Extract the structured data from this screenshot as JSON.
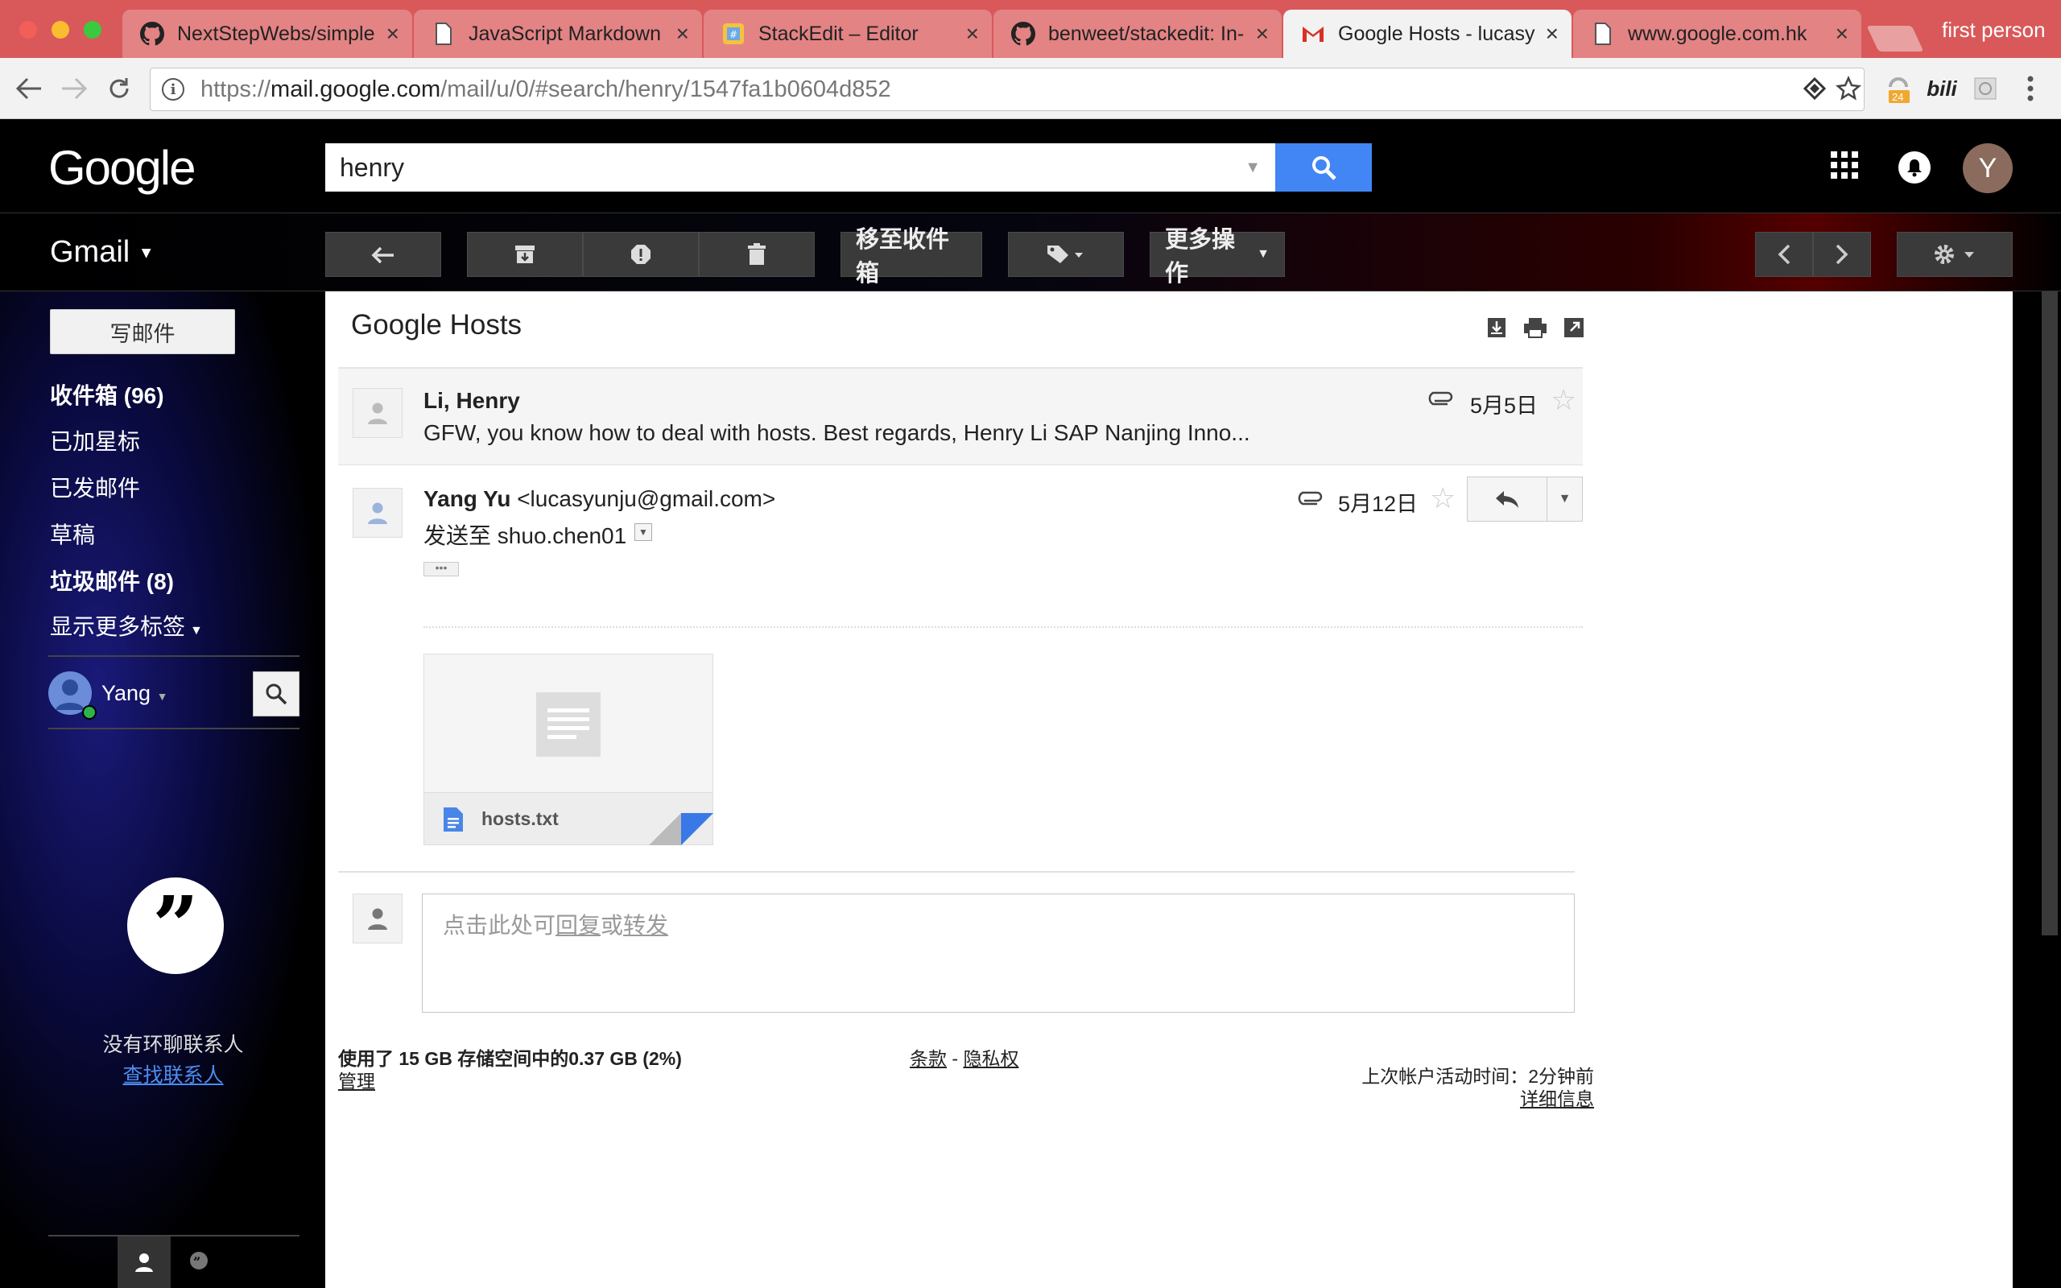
{
  "browser": {
    "tabs": [
      {
        "title": "NextStepWebs/simple",
        "favicon": "github-icon"
      },
      {
        "title": "JavaScript Markdown",
        "favicon": "page-icon"
      },
      {
        "title": "StackEdit – Editor",
        "favicon": "stackedit-icon"
      },
      {
        "title": "benweet/stackedit: In-",
        "favicon": "github-icon"
      },
      {
        "title": "Google Hosts - lucasy",
        "favicon": "gmail-icon",
        "active": true
      },
      {
        "title": "www.google.com.hk",
        "favicon": "page-icon"
      }
    ],
    "profile": "first person",
    "url_prefix": "https://",
    "url_host": "mail.google.com",
    "url_path": "/mail/u/0/#search/henry/1547fa1b0604d852",
    "extensions": {
      "badge": "24",
      "bili": "bili"
    }
  },
  "header": {
    "logo": "Google",
    "search_value": "henry",
    "avatar_letter": "Y"
  },
  "actionbar": {
    "gmail_label": "Gmail",
    "move_to_inbox": "移至收件箱",
    "more_actions": "更多操作"
  },
  "sidebar": {
    "compose": "写邮件",
    "items": [
      {
        "label": "收件箱 (96)",
        "bold": true
      },
      {
        "label": "已加星标",
        "bold": false
      },
      {
        "label": "已发邮件",
        "bold": false
      },
      {
        "label": "草稿",
        "bold": false
      },
      {
        "label": "垃圾邮件 (8)",
        "bold": true
      },
      {
        "label": "显示更多标签",
        "bold": false
      }
    ],
    "user_name": "Yang",
    "no_contacts": "没有环聊联系人",
    "find_contacts": "查找联系人"
  },
  "thread": {
    "subject": "Google Hosts",
    "messages": [
      {
        "from": "Li, Henry",
        "snippet": "GFW, you know how to deal with hosts. Best regards, Henry Li SAP Nanjing Inno...",
        "date": "5月5日"
      },
      {
        "from_name": "Yang Yu",
        "from_email": "<lucasyunju@gmail.com>",
        "to_prefix": "发送至",
        "to": "shuo.chen01",
        "date": "5月12日",
        "attachment": "hosts.txt"
      }
    ],
    "reply_hint_prefix": "点击此处可",
    "reply_hint_reply": "回复",
    "reply_hint_or": "或",
    "reply_hint_forward": "转发"
  },
  "footer": {
    "storage": "使用了 15 GB 存储空间中的0.37 GB (2%)",
    "manage": "管理",
    "terms": "条款",
    "separator": "-",
    "privacy": "隐私权",
    "last_activity": "上次帐户活动时间：2分钟前",
    "details": "详细信息"
  },
  "colors": {
    "accent": "#4285f4",
    "tabbar": "#d9595a"
  }
}
